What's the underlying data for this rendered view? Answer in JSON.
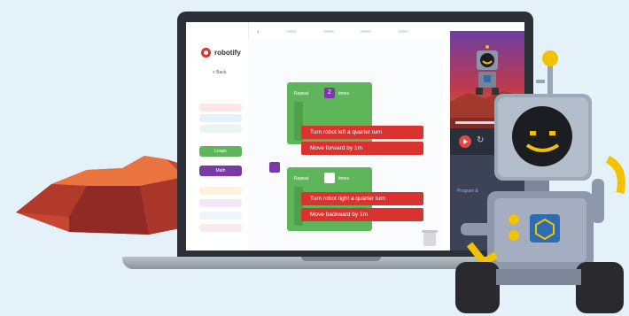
{
  "app": {
    "logo_text": "robotify",
    "back_label": "< Back"
  },
  "sidebar": {
    "categories": [
      {
        "label": "Movement",
        "color": "#d9322f"
      },
      {
        "label": "Loops",
        "color": "#5fb65a"
      },
      {
        "label": "Math",
        "color": "#7a3aa5"
      }
    ]
  },
  "workspace": {
    "repeat_blocks": [
      {
        "label": "Repeat",
        "count": "2",
        "suffix": "times",
        "actions": [
          "Turn robot left a quarter turn",
          "Move forward by 1m"
        ]
      },
      {
        "label": "Repeat",
        "count": "",
        "suffix": "times",
        "actions": [
          "Turn robot right a quarter turn",
          "Move backward by 1m"
        ]
      }
    ]
  },
  "game_panel": {
    "program_label": "Program &"
  },
  "icons": {
    "play": "play-icon",
    "reset": "reset-icon",
    "trash": "trash-icon"
  }
}
